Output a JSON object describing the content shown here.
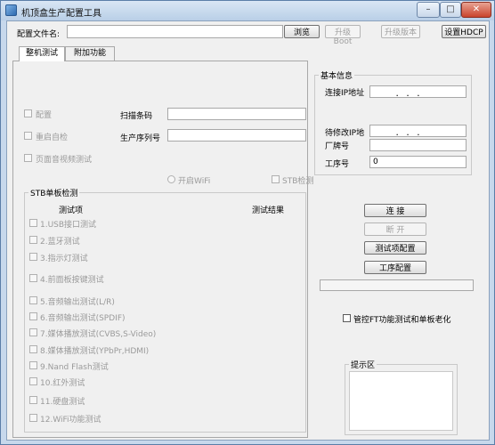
{
  "window": {
    "title": "机顶盒生产配置工具",
    "controls": {
      "minimize": "–",
      "maximize": "□",
      "close": "✕"
    }
  },
  "toolbar": {
    "config_file_label": "配置文件名:",
    "config_file_value": "",
    "browse_button": "浏览",
    "upgrade_boot_button": "升级Boot",
    "upgrade_version_button": "升级版本",
    "set_hdcp_button": "设置HDCP"
  },
  "tabs": [
    {
      "label": "整机测试",
      "active": true
    },
    {
      "label": "附加功能",
      "active": false
    }
  ],
  "machine_test": {
    "checkboxes": [
      {
        "label": "配置"
      },
      {
        "label": "重启自检"
      },
      {
        "label": "页面音视频测试"
      }
    ],
    "scan_barcode_label": "扫描条码",
    "serial_number_label": "生产序列号",
    "open_wifi_label": "开启WiFi",
    "stb_detect_label": "STB检测"
  },
  "basic_info": {
    "title": "基本信息",
    "connect_ip_label": "连接IP地址",
    "modify_ip_label": "待修改IP地",
    "vendor_label": "厂牌号",
    "process_label": "工序号",
    "process_value": "0",
    "ip_dots": "．   ．   ．"
  },
  "stb_board": {
    "title": "STB单板检测",
    "col_item": "测试项",
    "col_result": "测试结果",
    "items": [
      "1.USB接口测试",
      "2.蓝牙测试",
      "3.指示灯测试",
      "4.前面板按键测试",
      "5.音频输出测试(L/R)",
      "6.音频输出测试(SPDIF)",
      "7.媒体播放测试(CVBS,S-Video)",
      "8.媒体播放测试(YPbPr,HDMI)",
      "9.Nand Flash测试",
      "10.红外测试",
      "11.硬盘测试",
      "12.WiFi功能测试"
    ]
  },
  "actions": {
    "connect_button": "连 接",
    "disconnect_button": "断 开",
    "test_config_button": "测试项配置",
    "process_config_button": "工序配置"
  },
  "options": {
    "ft_aging_label": "管控FT功能测试和单板老化"
  },
  "hint": {
    "title": "提示区",
    "content": ""
  }
}
